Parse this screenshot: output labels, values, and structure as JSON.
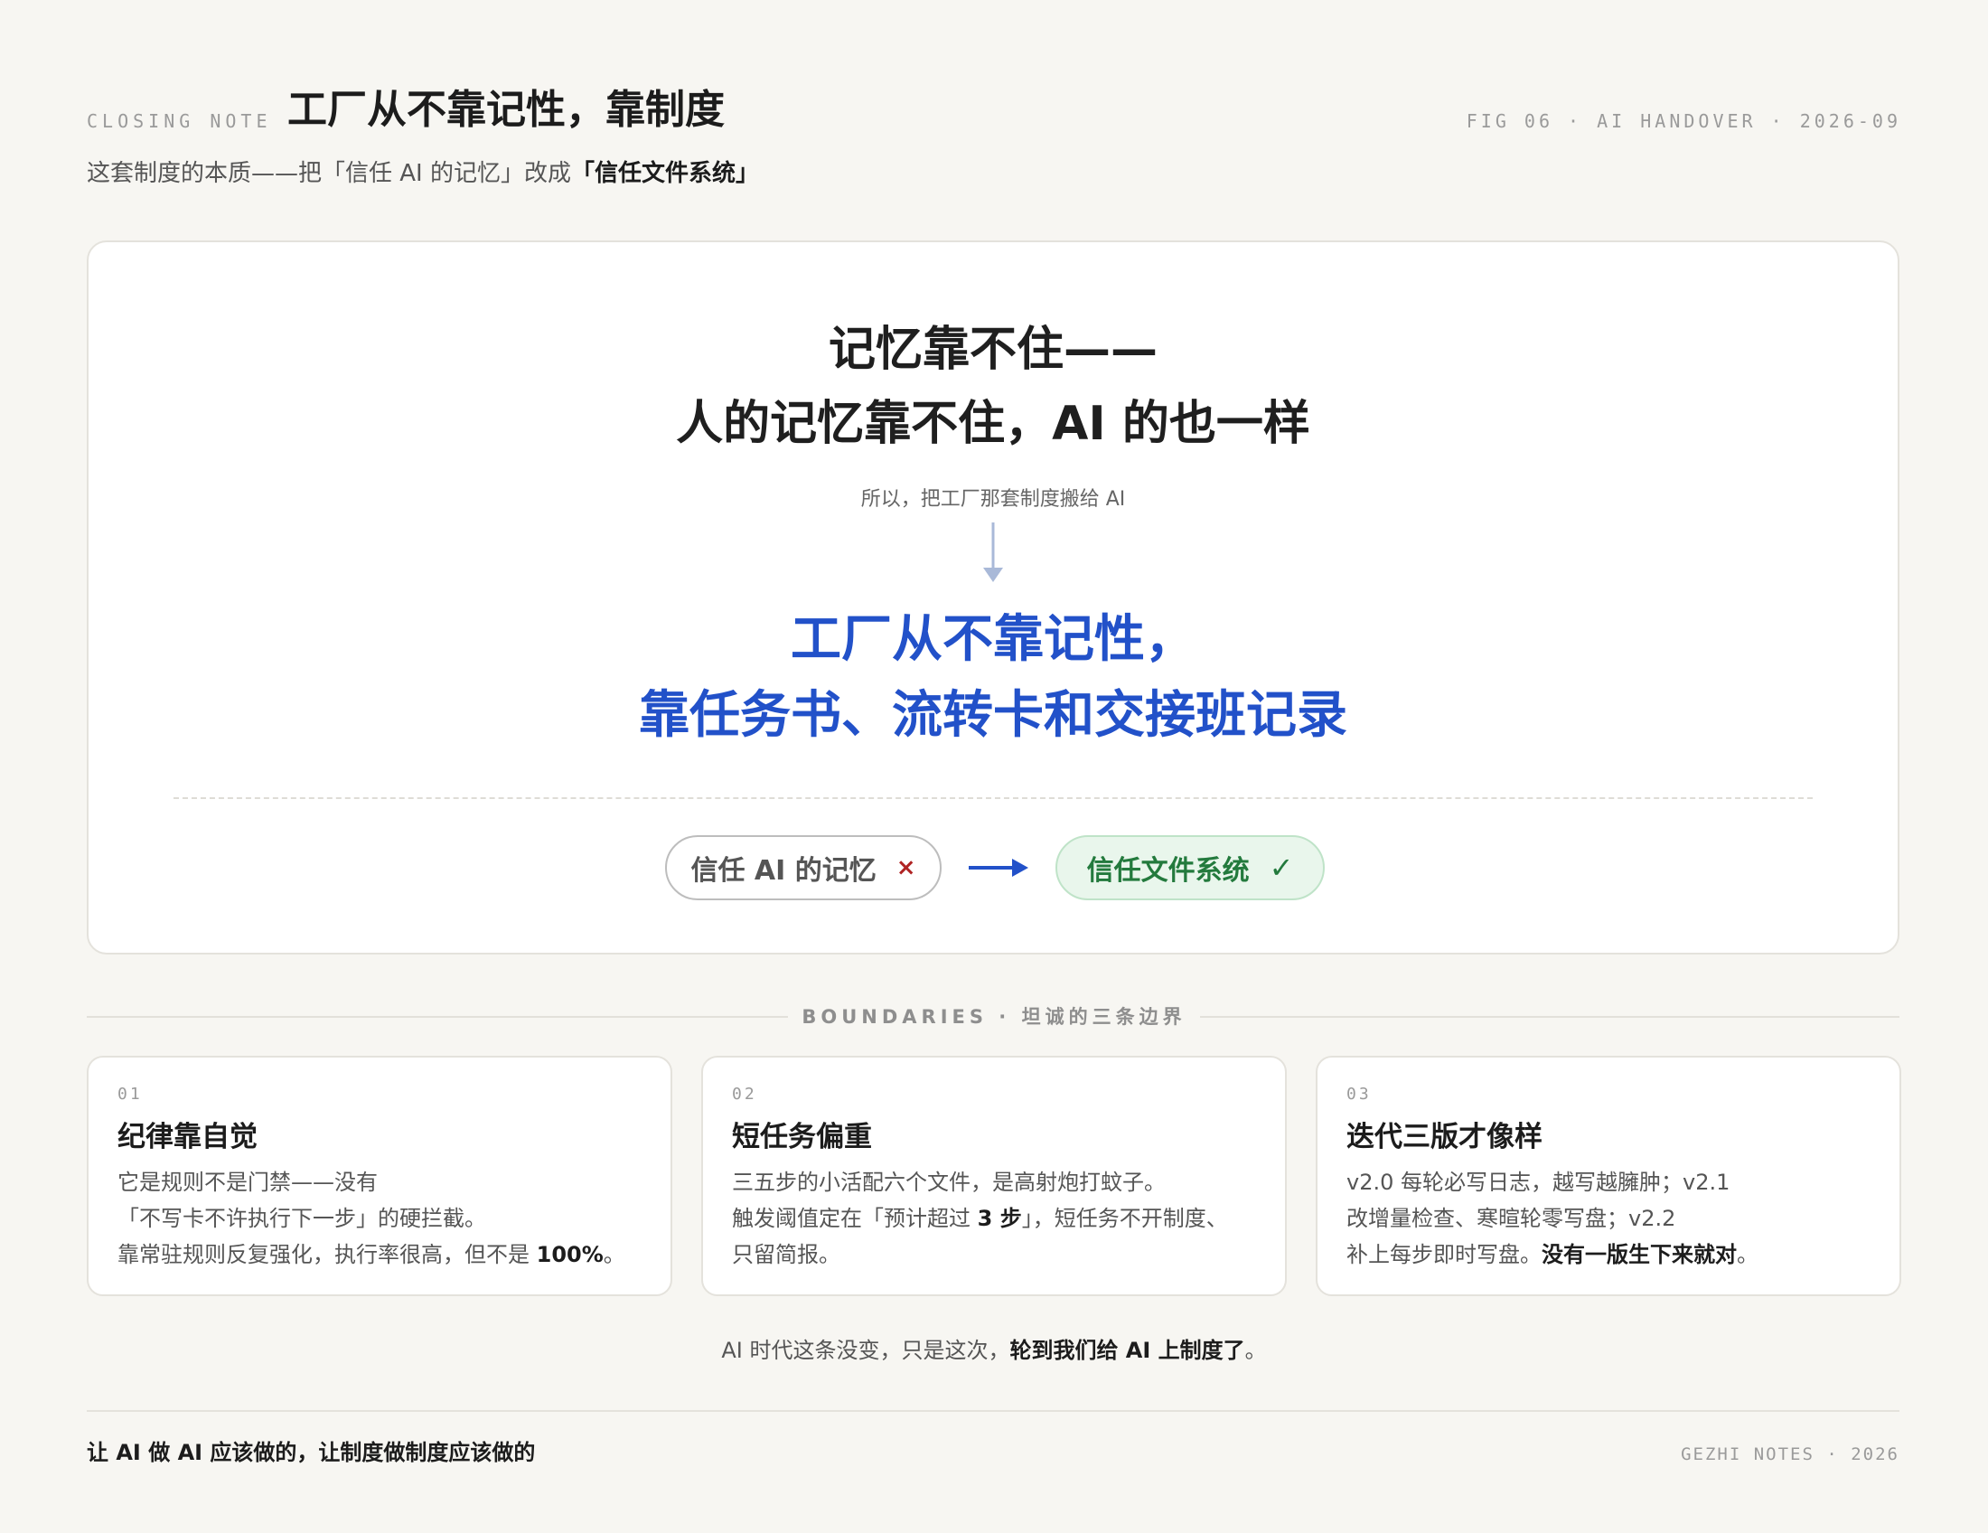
{
  "header": {
    "kicker": "CLOSING NOTE",
    "title": "工厂从不靠记性，靠制度",
    "fig_tag": "FIG 06 · AI HANDOVER · 2026-09",
    "subtitle_pre": "这套制度的本质——把「信任 AI 的记忆」改成",
    "subtitle_bold": "「信任文件系统」"
  },
  "main": {
    "line1": "记忆靠不住——",
    "line2": "人的记忆靠不住，AI 的也一样",
    "so_text": "所以，把工厂那套制度搬给 AI",
    "blue_line1": "工厂从不靠记性，",
    "blue_line2": "靠任务书、流转卡和交接班记录",
    "from_pill": {
      "label": "信任 AI 的记忆",
      "mark": "×"
    },
    "to_pill": {
      "label": "信任文件系统",
      "mark": "✓"
    }
  },
  "boundaries": {
    "title": "BOUNDARIES · 坦诚的三条边界",
    "cards": [
      {
        "num": "01",
        "title": "纪律靠自觉",
        "line1": "它是规则不是门禁——没有",
        "line2": "「不写卡不许执行下一步」的硬拦截。",
        "line3_pre": "靠常驻规则反复强化，执行率很高，但不是 ",
        "line3_bold": "100%",
        "line3_post": "。"
      },
      {
        "num": "02",
        "title": "短任务偏重",
        "line1": "三五步的小活配六个文件，是高射炮打蚊子。",
        "line2_pre": "触发阈值定在「预计超过 ",
        "line2_bold": "3 步",
        "line2_post": "」，短任务不开制度、",
        "line3": "只留简报。"
      },
      {
        "num": "03",
        "title": "迭代三版才像样",
        "line1": "v2.0 每轮必写日志，越写越臃肿；v2.1",
        "line2": "改增量检查、寒暄轮零写盘；v2.2",
        "line3_pre": "补上每步即时写盘。",
        "line3_bold": "没有一版生下来就对",
        "line3_post": "。"
      }
    ]
  },
  "closing": {
    "pre": "AI 时代这条没变，只是这次，",
    "bold": "轮到我们给 AI 上制度了",
    "post": "。"
  },
  "footer": {
    "left": "让 AI 做 AI 应该做的，让制度做制度应该做的",
    "right": "GEZHI NOTES · 2026"
  },
  "colors": {
    "accent_blue": "#2251c9",
    "good_green": "#237a3d",
    "bad_red": "#b02424",
    "background": "#f7f6f2"
  },
  "icons": {
    "down_arrow": "arrow-down-icon",
    "right_arrow": "arrow-right-icon",
    "cross": "cross-icon",
    "check": "check-icon"
  }
}
